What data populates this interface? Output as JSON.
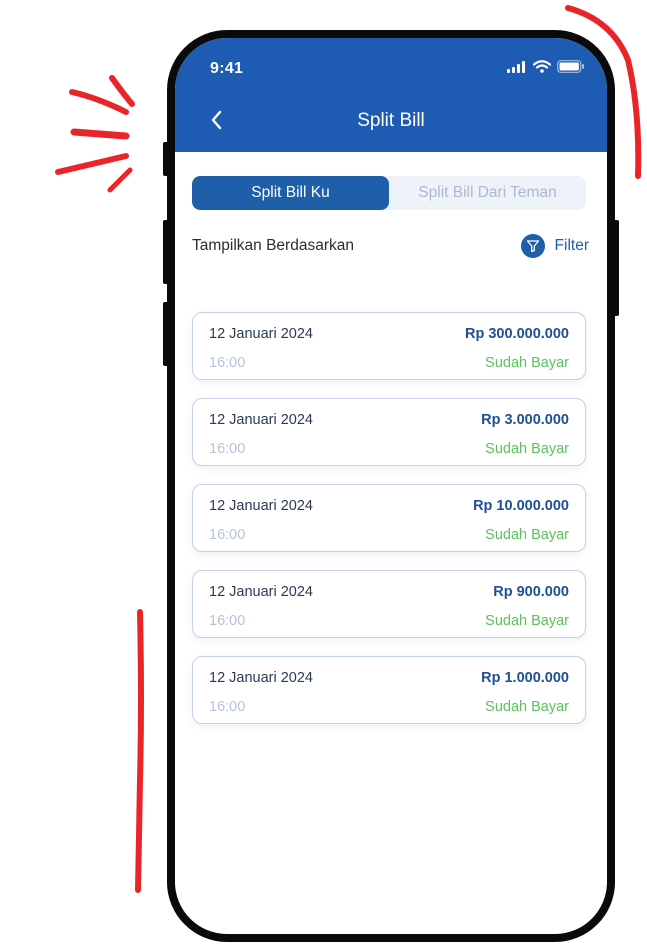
{
  "status_bar": {
    "time": "9:41"
  },
  "header": {
    "title": "Split Bill"
  },
  "tabs": [
    {
      "label": "Split Bill Ku",
      "active": true
    },
    {
      "label": "Split Bill Dari Teman",
      "active": false
    }
  ],
  "filter": {
    "label": "Tampilkan Berdasarkan",
    "button_label": "Filter"
  },
  "bills": [
    {
      "date": "12 Januari 2024",
      "amount": "Rp 300.000.000",
      "time": "16:00",
      "status": "Sudah Bayar"
    },
    {
      "date": "12 Januari 2024",
      "amount": "Rp 3.000.000",
      "time": "16:00",
      "status": "Sudah Bayar"
    },
    {
      "date": "12 Januari 2024",
      "amount": "Rp 10.000.000",
      "time": "16:00",
      "status": "Sudah Bayar"
    },
    {
      "date": "12 Januari 2024",
      "amount": "Rp 900.000",
      "time": "16:00",
      "status": "Sudah Bayar"
    },
    {
      "date": "12 Januari 2024",
      "amount": "Rp 1.000.000",
      "time": "16:00",
      "status": "Sudah Bayar"
    }
  ],
  "colors": {
    "header": "#1e5cb3",
    "accent": "#1f5ea8",
    "paid": "#5dc15d",
    "decoration": "#e8262a"
  }
}
